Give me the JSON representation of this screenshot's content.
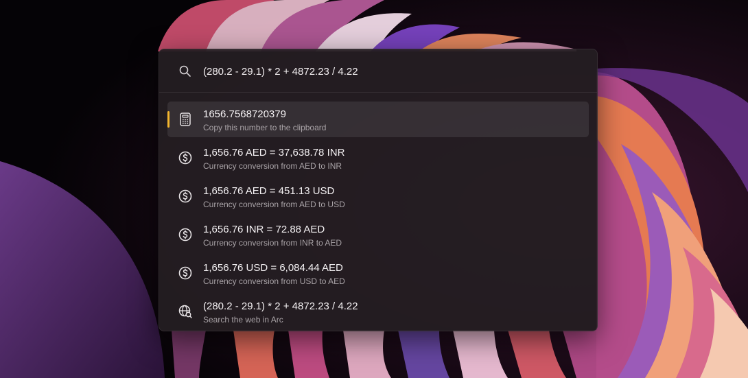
{
  "search": {
    "query": "(280.2 - 29.1) * 2 + 4872.23 / 4.22",
    "icon": "search-icon"
  },
  "results": [
    {
      "title": "1656.7568720379",
      "subtitle": "Copy this number to the clipboard",
      "icon": "calculator-icon",
      "selected": true
    },
    {
      "title": "1,656.76 AED = 37,638.78 INR",
      "subtitle": "Currency conversion from AED to INR",
      "icon": "currency-icon",
      "selected": false
    },
    {
      "title": "1,656.76 AED = 451.13 USD",
      "subtitle": "Currency conversion from AED to USD",
      "icon": "currency-icon",
      "selected": false
    },
    {
      "title": "1,656.76 INR = 72.88 AED",
      "subtitle": "Currency conversion from INR to AED",
      "icon": "currency-icon",
      "selected": false
    },
    {
      "title": "1,656.76 USD = 6,084.44 AED",
      "subtitle": "Currency conversion from USD to AED",
      "icon": "currency-icon",
      "selected": false
    },
    {
      "title": "(280.2 - 29.1) * 2 + 4872.23 / 4.22",
      "subtitle": "Search the web in Arc",
      "icon": "web-search-icon",
      "selected": false
    }
  ],
  "colors": {
    "accent": "#f2b52e",
    "panel": "#241e22",
    "text_primary": "#f4f1f3",
    "text_secondary": "#a9a3a7"
  }
}
